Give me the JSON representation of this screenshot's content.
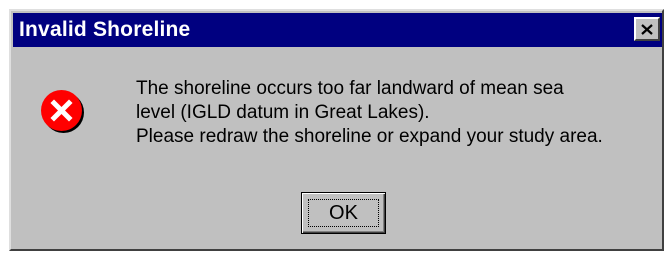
{
  "window": {
    "title": "Invalid Shoreline",
    "close_label": "X"
  },
  "dialog": {
    "icon": "error-x-icon",
    "message_lines": [
      "The shoreline occurs too far landward of mean sea",
      "level (IGLD datum in Great Lakes).",
      "Please redraw the shoreline or expand your study area."
    ],
    "ok_label": "OK"
  },
  "colors": {
    "titlebar": "#000080",
    "dialog_bg": "#c0c0c0",
    "icon_red": "#ff0000"
  }
}
